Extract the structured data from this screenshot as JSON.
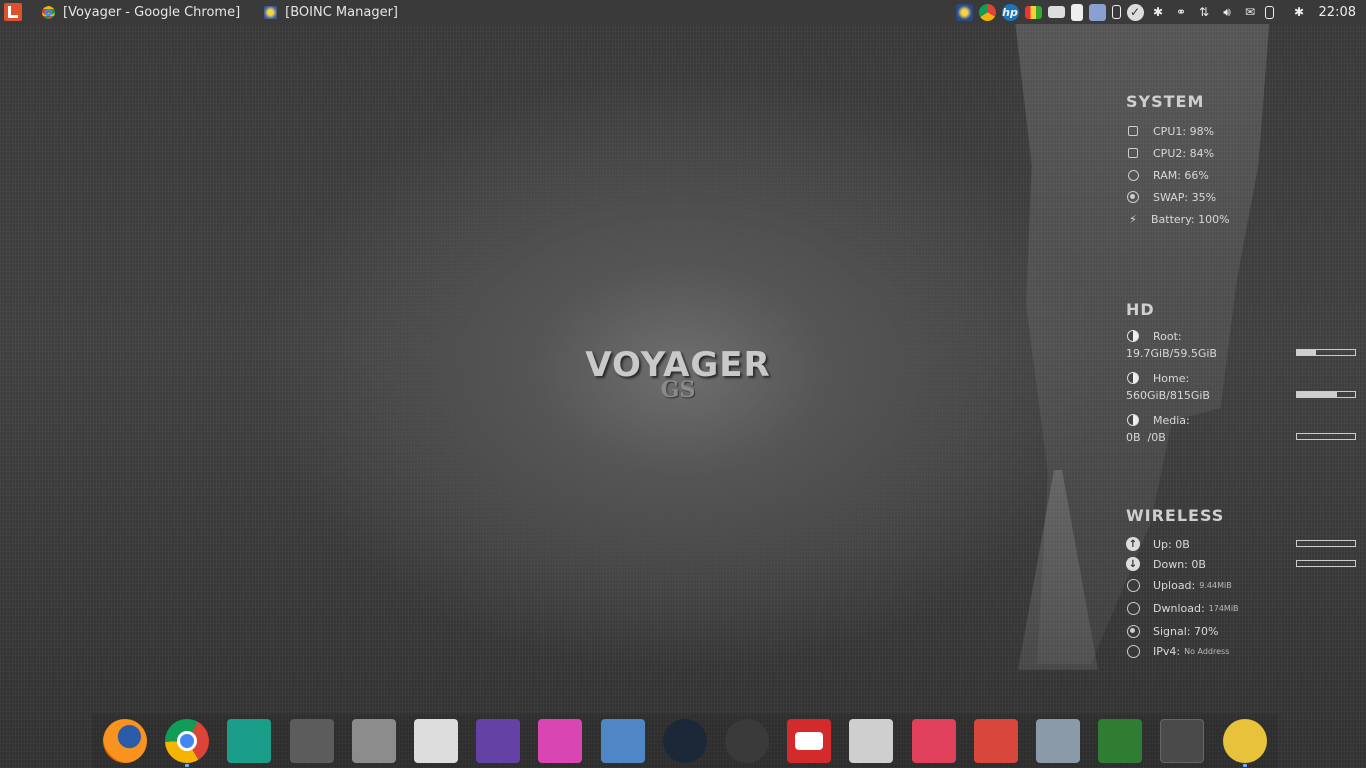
{
  "topbar": {
    "tasks": [
      {
        "label": "[Voyager - Google Chrome]",
        "icon": "chrome-icon"
      },
      {
        "label": "[BOINC Manager]",
        "icon": "boinc-icon"
      }
    ],
    "tray_icons": [
      "boinc-icon",
      "chrome-icon",
      "hp-icon",
      "calendar-icon",
      "window-icon",
      "document-icon",
      "mail-icon",
      "battery-icon",
      "clock-icon",
      "bluetooth-icon",
      "link-icon",
      "network-icon",
      "volume-icon",
      "envelope-icon",
      "power-icon",
      "bluetooth-icon"
    ],
    "clock": "22:08"
  },
  "logo": {
    "main": "VOYAGER",
    "sub": "GS"
  },
  "conky": {
    "system": {
      "title": "SYSTEM",
      "rows": [
        {
          "label": "CPU1: 98%"
        },
        {
          "label": "CPU2: 84%"
        },
        {
          "label": "RAM: 66%"
        },
        {
          "label": "SWAP: 35%"
        },
        {
          "label": "Battery: 100%"
        }
      ]
    },
    "hd": {
      "title": "HD",
      "rows": [
        {
          "label": "Root:",
          "value": "19.7GiB/59.5GiB",
          "usage": 0.33
        },
        {
          "label": "Home:",
          "value": "560GiB/815GiB",
          "usage": 0.69
        },
        {
          "label": "Media:",
          "value": "0B  /0B",
          "usage": 0.0
        }
      ]
    },
    "wireless": {
      "title": "WIRELESS",
      "rows": [
        {
          "label": "Up: 0B",
          "small": ""
        },
        {
          "label": "Down: 0B",
          "small": ""
        },
        {
          "label": "Upload:",
          "small": "9.44MiB"
        },
        {
          "label": "Dwnload:",
          "small": "174MiB"
        },
        {
          "label": "Signal: 70%",
          "small": ""
        },
        {
          "label": "IPv4:",
          "small": "No Address"
        }
      ]
    }
  },
  "dock": {
    "apps": [
      {
        "name": "firefox",
        "color": "#e66000"
      },
      {
        "name": "chrome",
        "color": "#4285f4",
        "running": true
      },
      {
        "name": "notebook",
        "color": "#1a9e8a"
      },
      {
        "name": "calculator",
        "color": "#5c5c5c"
      },
      {
        "name": "files",
        "color": "#8c8c8c"
      },
      {
        "name": "text-editor",
        "color": "#dddddd"
      },
      {
        "name": "twitch",
        "color": "#6441a5"
      },
      {
        "name": "app-grid",
        "color": "#d946b3"
      },
      {
        "name": "desktop",
        "color": "#4f86c6"
      },
      {
        "name": "steam",
        "color": "#1b2838"
      },
      {
        "name": "dial",
        "color": "#3a3a3a"
      },
      {
        "name": "youtube",
        "color": "#d32b2b"
      },
      {
        "name": "store",
        "color": "#cfcfcf"
      },
      {
        "name": "mixer",
        "color": "#e0405a"
      },
      {
        "name": "trash",
        "color": "#d9463c"
      },
      {
        "name": "screenshot",
        "color": "#8a9aa8"
      },
      {
        "name": "system-monitor",
        "color": "#2e7d32"
      },
      {
        "name": "terminal",
        "color": "#4a4a4a"
      },
      {
        "name": "boinc",
        "color": "#e8c23a",
        "running": true
      }
    ]
  }
}
